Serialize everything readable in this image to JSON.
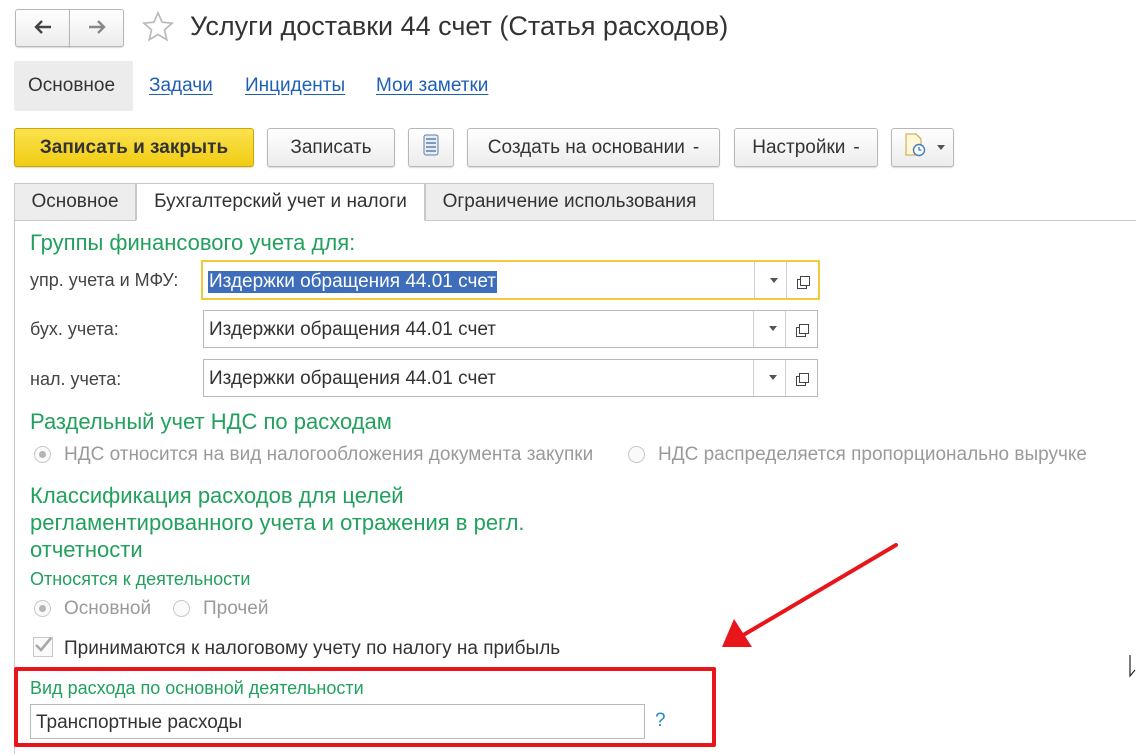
{
  "header": {
    "title": "Услуги доставки 44 счет (Статья расходов)",
    "back_icon": "arrow-left-icon",
    "forward_icon": "arrow-right-icon",
    "favorite_icon": "star-icon"
  },
  "nav_links": [
    {
      "label": "Основное"
    },
    {
      "label": "Задачи"
    },
    {
      "label": "Инциденты"
    },
    {
      "label": "Мои заметки"
    }
  ],
  "toolbar": {
    "save_close": "Записать и закрыть",
    "save": "Записать",
    "create_based": "Создать на основании",
    "settings": "Настройки",
    "dropdown_marker": "-"
  },
  "tabs": [
    {
      "label": "Основное"
    },
    {
      "label": "Бухгалтерский учет и налоги"
    },
    {
      "label": "Ограничение использования"
    }
  ],
  "fin_groups": {
    "heading": "Группы финансового учета для:",
    "rows": [
      {
        "label": "упр. учета и МФУ:",
        "value": "Издержки обращения 44.01 счет"
      },
      {
        "label": "бух. учета:",
        "value": "Издержки обращения 44.01 счет"
      },
      {
        "label": "нал. учета:",
        "value": "Издержки обращения 44.01 счет"
      }
    ]
  },
  "vat": {
    "heading": "Раздельный учет НДС по расходам",
    "option1": "НДС относится на вид налогообложения документа закупки",
    "option2": "НДС распределяется пропорционально выручке"
  },
  "classification": {
    "heading_line1": "Классификация расходов для целей",
    "heading_line2": "регламентированного учета и отражения в регл.",
    "heading_line3": "отчетности",
    "activity_label": "Относятся к деятельности",
    "activity_opt1": "Основной",
    "activity_opt2": "Прочей",
    "checkbox_label": "Принимаются к налоговому учету по налогу на прибыль"
  },
  "expense_kind": {
    "label": "Вид расхода по основной деятельности",
    "value": "Транспортные расходы",
    "help": "?"
  },
  "colors": {
    "accent_yellow": "#f5d21e",
    "heading_green": "#21a15d",
    "highlight_red": "#e8151b",
    "link_blue": "#1e5fb5"
  }
}
